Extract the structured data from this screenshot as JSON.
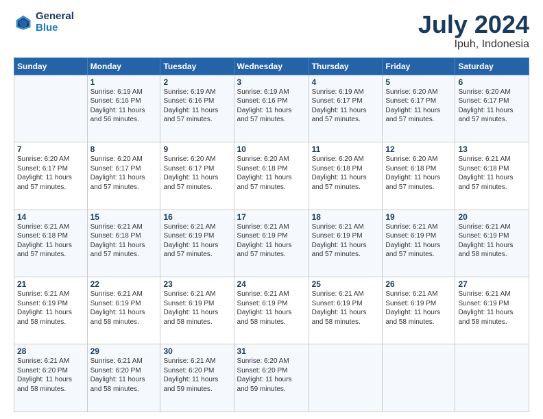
{
  "header": {
    "logo_line1": "General",
    "logo_line2": "Blue",
    "title": "July 2024",
    "subtitle": "Ipuh, Indonesia"
  },
  "weekdays": [
    "Sunday",
    "Monday",
    "Tuesday",
    "Wednesday",
    "Thursday",
    "Friday",
    "Saturday"
  ],
  "weeks": [
    [
      {
        "day": "",
        "info": ""
      },
      {
        "day": "1",
        "info": "Sunrise: 6:19 AM\nSunset: 6:16 PM\nDaylight: 11 hours\nand 56 minutes."
      },
      {
        "day": "2",
        "info": "Sunrise: 6:19 AM\nSunset: 6:16 PM\nDaylight: 11 hours\nand 57 minutes."
      },
      {
        "day": "3",
        "info": "Sunrise: 6:19 AM\nSunset: 6:16 PM\nDaylight: 11 hours\nand 57 minutes."
      },
      {
        "day": "4",
        "info": "Sunrise: 6:19 AM\nSunset: 6:17 PM\nDaylight: 11 hours\nand 57 minutes."
      },
      {
        "day": "5",
        "info": "Sunrise: 6:20 AM\nSunset: 6:17 PM\nDaylight: 11 hours\nand 57 minutes."
      },
      {
        "day": "6",
        "info": "Sunrise: 6:20 AM\nSunset: 6:17 PM\nDaylight: 11 hours\nand 57 minutes."
      }
    ],
    [
      {
        "day": "7",
        "info": "Sunrise: 6:20 AM\nSunset: 6:17 PM\nDaylight: 11 hours\nand 57 minutes."
      },
      {
        "day": "8",
        "info": "Sunrise: 6:20 AM\nSunset: 6:17 PM\nDaylight: 11 hours\nand 57 minutes."
      },
      {
        "day": "9",
        "info": "Sunrise: 6:20 AM\nSunset: 6:17 PM\nDaylight: 11 hours\nand 57 minutes."
      },
      {
        "day": "10",
        "info": "Sunrise: 6:20 AM\nSunset: 6:18 PM\nDaylight: 11 hours\nand 57 minutes."
      },
      {
        "day": "11",
        "info": "Sunrise: 6:20 AM\nSunset: 6:18 PM\nDaylight: 11 hours\nand 57 minutes."
      },
      {
        "day": "12",
        "info": "Sunrise: 6:20 AM\nSunset: 6:18 PM\nDaylight: 11 hours\nand 57 minutes."
      },
      {
        "day": "13",
        "info": "Sunrise: 6:21 AM\nSunset: 6:18 PM\nDaylight: 11 hours\nand 57 minutes."
      }
    ],
    [
      {
        "day": "14",
        "info": "Sunrise: 6:21 AM\nSunset: 6:18 PM\nDaylight: 11 hours\nand 57 minutes."
      },
      {
        "day": "15",
        "info": "Sunrise: 6:21 AM\nSunset: 6:18 PM\nDaylight: 11 hours\nand 57 minutes."
      },
      {
        "day": "16",
        "info": "Sunrise: 6:21 AM\nSunset: 6:19 PM\nDaylight: 11 hours\nand 57 minutes."
      },
      {
        "day": "17",
        "info": "Sunrise: 6:21 AM\nSunset: 6:19 PM\nDaylight: 11 hours\nand 57 minutes."
      },
      {
        "day": "18",
        "info": "Sunrise: 6:21 AM\nSunset: 6:19 PM\nDaylight: 11 hours\nand 57 minutes."
      },
      {
        "day": "19",
        "info": "Sunrise: 6:21 AM\nSunset: 6:19 PM\nDaylight: 11 hours\nand 57 minutes."
      },
      {
        "day": "20",
        "info": "Sunrise: 6:21 AM\nSunset: 6:19 PM\nDaylight: 11 hours\nand 58 minutes."
      }
    ],
    [
      {
        "day": "21",
        "info": "Sunrise: 6:21 AM\nSunset: 6:19 PM\nDaylight: 11 hours\nand 58 minutes."
      },
      {
        "day": "22",
        "info": "Sunrise: 6:21 AM\nSunset: 6:19 PM\nDaylight: 11 hours\nand 58 minutes."
      },
      {
        "day": "23",
        "info": "Sunrise: 6:21 AM\nSunset: 6:19 PM\nDaylight: 11 hours\nand 58 minutes."
      },
      {
        "day": "24",
        "info": "Sunrise: 6:21 AM\nSunset: 6:19 PM\nDaylight: 11 hours\nand 58 minutes."
      },
      {
        "day": "25",
        "info": "Sunrise: 6:21 AM\nSunset: 6:19 PM\nDaylight: 11 hours\nand 58 minutes."
      },
      {
        "day": "26",
        "info": "Sunrise: 6:21 AM\nSunset: 6:19 PM\nDaylight: 11 hours\nand 58 minutes."
      },
      {
        "day": "27",
        "info": "Sunrise: 6:21 AM\nSunset: 6:19 PM\nDaylight: 11 hours\nand 58 minutes."
      }
    ],
    [
      {
        "day": "28",
        "info": "Sunrise: 6:21 AM\nSunset: 6:20 PM\nDaylight: 11 hours\nand 58 minutes."
      },
      {
        "day": "29",
        "info": "Sunrise: 6:21 AM\nSunset: 6:20 PM\nDaylight: 11 hours\nand 58 minutes."
      },
      {
        "day": "30",
        "info": "Sunrise: 6:21 AM\nSunset: 6:20 PM\nDaylight: 11 hours\nand 59 minutes."
      },
      {
        "day": "31",
        "info": "Sunrise: 6:20 AM\nSunset: 6:20 PM\nDaylight: 11 hours\nand 59 minutes."
      },
      {
        "day": "",
        "info": ""
      },
      {
        "day": "",
        "info": ""
      },
      {
        "day": "",
        "info": ""
      }
    ]
  ]
}
